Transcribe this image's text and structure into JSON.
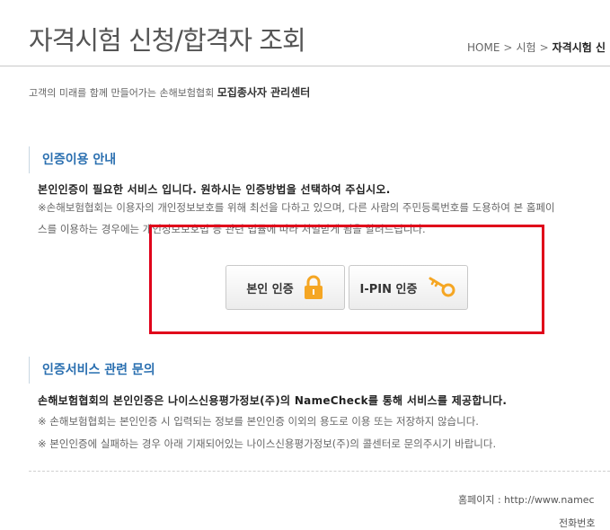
{
  "header": {
    "title": "자격시험 신청/합격자 조회",
    "breadcrumb": [
      "HOME",
      "시험",
      "자격시험 신"
    ]
  },
  "subtitle": {
    "prefix": "고객의 미래를 함께 만들어가는 손해보험협회",
    "strong": "모집종사자 관리센터"
  },
  "auth_guide": {
    "heading": "인증이용 안내",
    "lead": "본인인증이 필요한 서비스 입니다. 원하시는 인증방법을 선택하여 주십시오.",
    "notes": [
      "※손해보험협회는 이용자의 개인정보보호를 위해 최선을 다하고 있으며, 다른 사람의 주민등록번호를 도용하여 본 홈페이",
      "스를 이용하는 경우에는 개인정보보호법 등 관련 법률에 따라 처벌받게 됨을 알려드립니다."
    ]
  },
  "auth_buttons": {
    "self": {
      "label": "본인 인증",
      "icon": "padlock-icon",
      "color": "#f5a623"
    },
    "ipin": {
      "label": "I-PIN 인증",
      "icon": "key-icon",
      "color": "#f5a623"
    }
  },
  "inquiry": {
    "heading": "인증서비스 관련 문의",
    "lead": "손해보험협회의 본인인증은 나이스신용평가정보(주)의 NameCheck를 통해 서비스를 제공합니다.",
    "notes": [
      "※ 손해보험협회는 본인인증 시 입력되는 정보를 본인인증 이외의 용도로 이용 또는 저장하지 않습니다.",
      "※ 본인인증에 실패하는 경우 아래 기재되어있는 나이스신용평가정보(주)의 콜센터로 문의주시기 바랍니다."
    ]
  },
  "footer": {
    "homepage": "홈페이지 : http://www.namec",
    "phone": "전화번호"
  },
  "colors": {
    "accent": "#2a6fb0",
    "highlight_border": "#e0001a",
    "icon": "#f5a623"
  }
}
